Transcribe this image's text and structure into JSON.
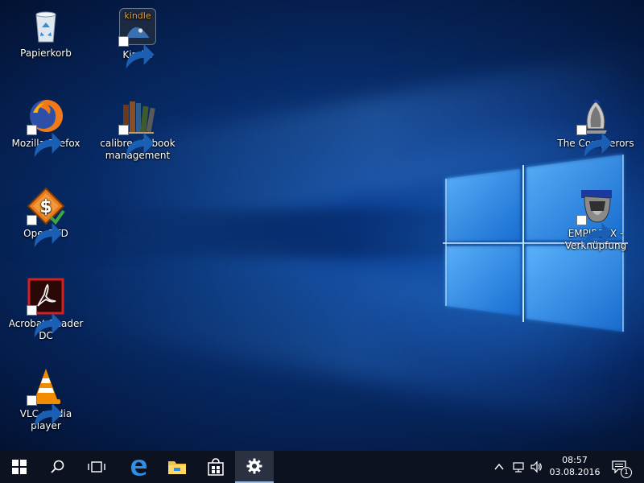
{
  "desktop": {
    "icons": [
      {
        "label": "Papierkorb",
        "icon": "recycle-bin-icon"
      },
      {
        "label": "Kindle",
        "icon": "kindle-icon",
        "badge_text": "kindle"
      },
      {
        "label": "Mozilla Firefox",
        "icon": "firefox-icon"
      },
      {
        "label": "calibre - E-book management",
        "icon": "calibre-icon"
      },
      {
        "label": "The Conquerors",
        "icon": "conquerors-icon"
      },
      {
        "label": "OpenTTD",
        "icon": "openttd-icon"
      },
      {
        "label": "EMPIRESX - Verknüpfung",
        "icon": "empiresx-icon"
      },
      {
        "label": "Acrobat Reader DC",
        "icon": "acrobat-icon"
      },
      {
        "label": "VLC media player",
        "icon": "vlc-icon"
      }
    ]
  },
  "taskbar": {
    "buttons": [
      {
        "name": "start",
        "icon": "windows-start-icon"
      },
      {
        "name": "search",
        "icon": "search-icon"
      },
      {
        "name": "task-view",
        "icon": "task-view-icon"
      },
      {
        "name": "edge",
        "icon": "edge-icon"
      },
      {
        "name": "file-explorer",
        "icon": "folder-icon"
      },
      {
        "name": "store",
        "icon": "store-icon"
      },
      {
        "name": "settings",
        "icon": "gear-icon",
        "active": true
      }
    ],
    "tray": {
      "icons": [
        "chevron-up-icon",
        "network-icon",
        "volume-icon"
      ],
      "time": "08:57",
      "date": "03.08.2016",
      "notification_count": "1"
    }
  },
  "colors": {
    "taskbar": "#0c1220",
    "accent": "#1e90ff",
    "acrobat_red": "#d32020",
    "vlc_orange": "#f18b00"
  }
}
